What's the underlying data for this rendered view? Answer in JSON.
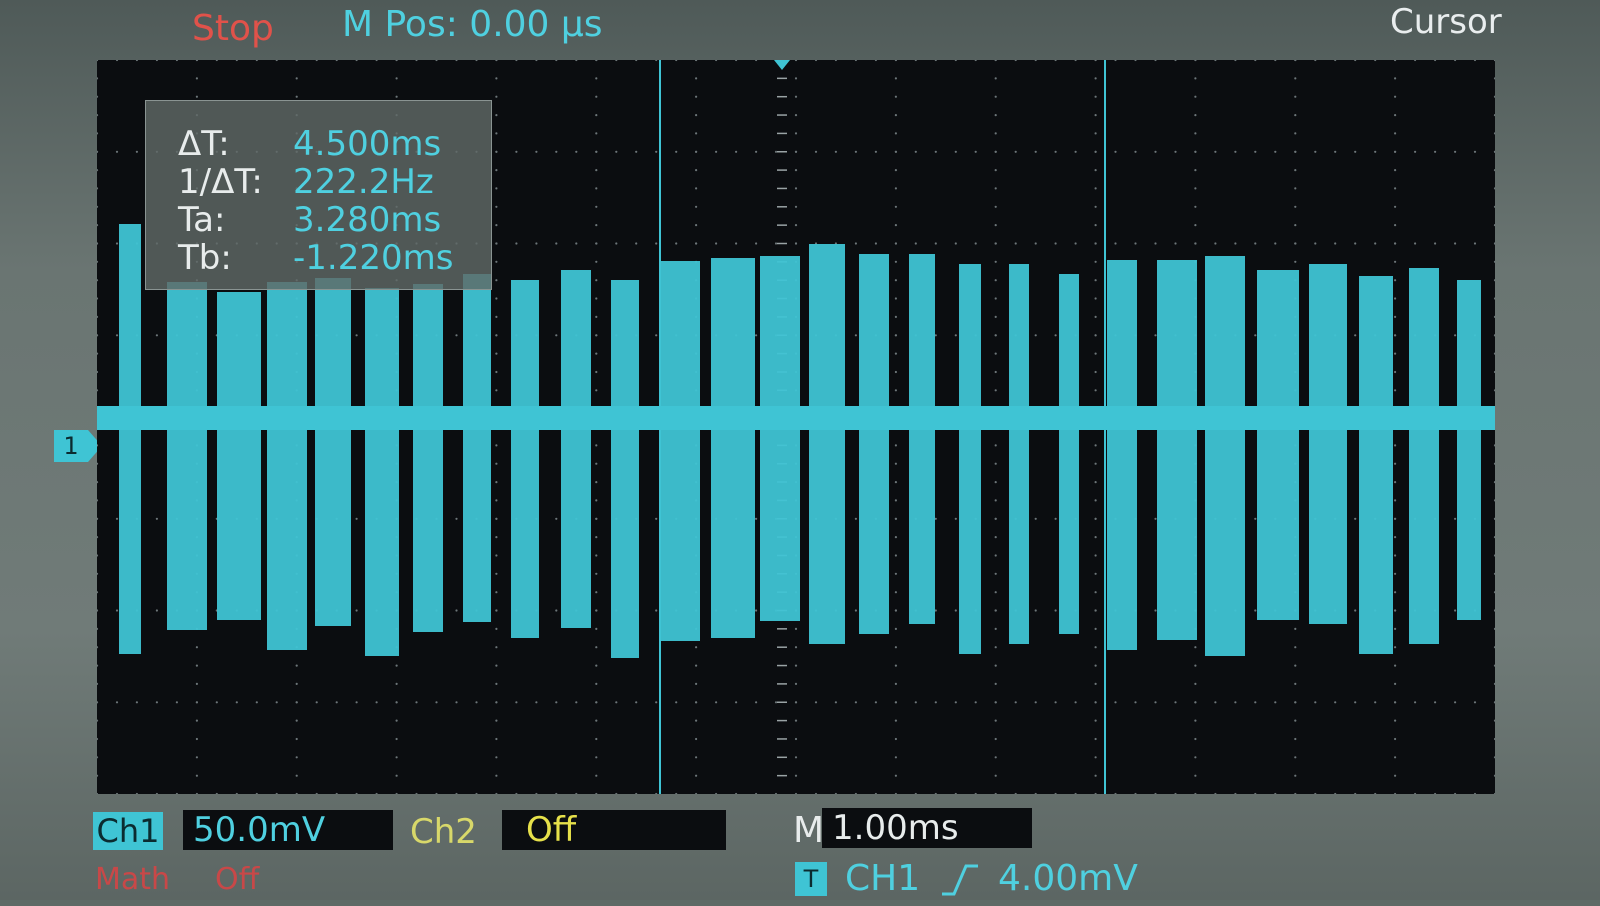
{
  "header": {
    "run_state": "Stop",
    "horizontal_position": "M Pos: 0.00 µs",
    "menu_title": "Cursor"
  },
  "cursor_readout": {
    "delta_t_label": "ΔT:",
    "delta_t_value": "4.500ms",
    "inv_delta_t_label": "1/ΔT:",
    "inv_delta_t_value": "222.2Hz",
    "ta_label": "Ta:",
    "ta_value": "3.280ms",
    "tb_label": "Tb:",
    "tb_value": "-1.220ms"
  },
  "channel_marker": "1",
  "footer": {
    "ch1_label": "Ch1",
    "ch1_scale": "50.0mV",
    "ch2_label": "Ch2",
    "ch2_scale": "Off",
    "math_label": "Math",
    "math_state": "Off",
    "timebase_label": "M",
    "timebase_scale": "1.00ms",
    "trigger_icon": "T",
    "trigger_source": "CH1",
    "trigger_edge_icon": "rising-edge-icon",
    "trigger_level": "4.00mV"
  },
  "colors": {
    "ch1": "#3fc4d4",
    "ch2": "#e6e04a",
    "stop": "#e0524a",
    "math": "#c84848",
    "screen_bg": "#0b0d10"
  }
}
